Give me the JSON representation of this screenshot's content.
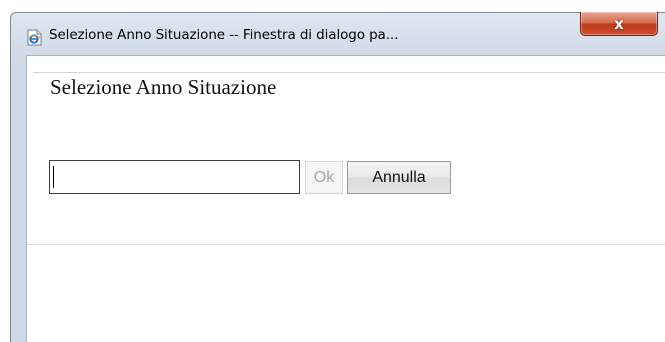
{
  "window": {
    "title": "Selezione Anno Situazione -- Finestra di dialogo pa...",
    "close_label": "x",
    "icon": "ie-page-icon"
  },
  "form": {
    "legend": "Selezione Anno Situazione",
    "year_value": "",
    "ok_label": "Ok",
    "ok_enabled": false,
    "cancel_label": "Annulla"
  },
  "colors": {
    "close_button": "#c9502f",
    "window_frame": "#d4dde9"
  }
}
